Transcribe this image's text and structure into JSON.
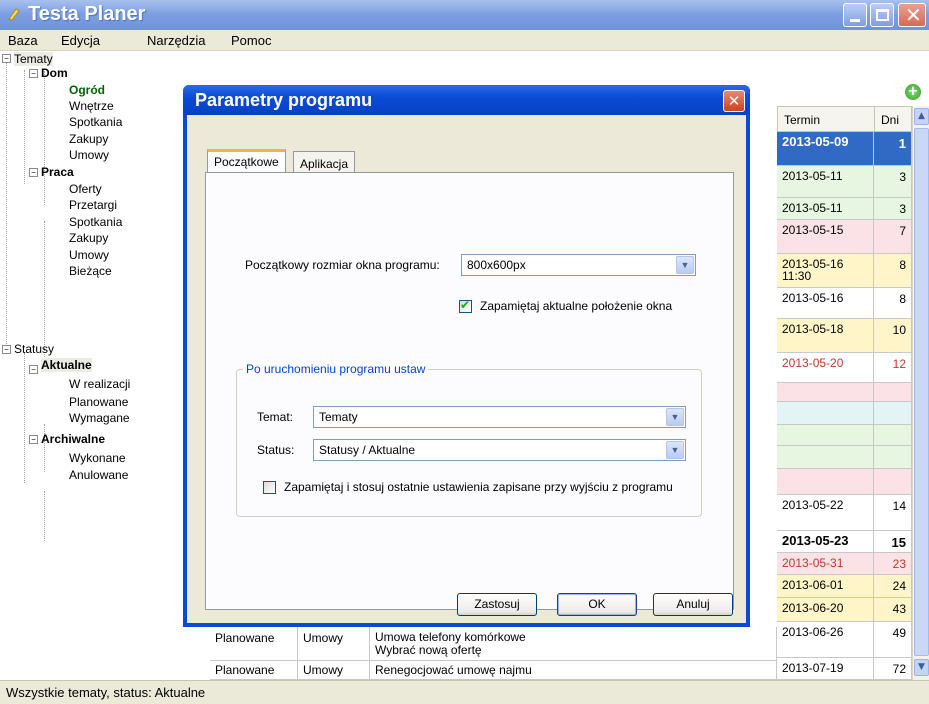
{
  "app": {
    "title": "Testa Planer",
    "menu": [
      "Baza",
      "Edycja",
      "Narzędzia",
      "Pomoc"
    ],
    "status": "Wszystkie tematy, status: Aktualne"
  },
  "tree": {
    "root1": "Tematy",
    "dom": "Dom",
    "dom_items": [
      "Ogród",
      "Wnętrze",
      "Spotkania",
      "Zakupy",
      "Umowy"
    ],
    "praca": "Praca",
    "praca_items": [
      "Oferty",
      "Przetargi",
      "Spotkania",
      "Zakupy",
      "Umowy",
      "Bieżące"
    ],
    "root2": "Statusy",
    "aktualne": "Aktualne",
    "aktualne_items": [
      "W realizacji",
      "Planowane",
      "Wymagane"
    ],
    "archiwalne": "Archiwalne",
    "archiwalne_items": [
      "Wykonane",
      "Anulowane"
    ]
  },
  "grid": {
    "headers": {
      "termin": "Termin",
      "dni": "Dni"
    },
    "rows": [
      {
        "termin": "2013-05-09",
        "dni": "1",
        "bg": "#316ac5",
        "color": "#ffffff",
        "bold": true
      },
      {
        "termin": "2013-05-11",
        "dni": "3",
        "bg": "#e6f6e0",
        "color": "#000000"
      },
      {
        "termin": "2013-05-11",
        "dni": "3",
        "bg": "#e6f6e0",
        "color": "#000000"
      },
      {
        "termin": "2013-05-15",
        "dni": "7",
        "bg": "#fbe2e6",
        "color": "#000000"
      },
      {
        "termin": "2013-05-16 11:30",
        "dni": "8",
        "bg": "#fff5c8",
        "color": "#000000"
      },
      {
        "termin": "2013-05-16",
        "dni": "8",
        "bg": "#ffffff",
        "color": "#000000"
      },
      {
        "termin": "2013-05-18",
        "dni": "10",
        "bg": "#fff5c8",
        "color": "#000000"
      },
      {
        "termin": "2013-05-20",
        "dni": "12",
        "bg": "#ffffff",
        "color": "#c0392b"
      },
      {
        "termin": "",
        "dni": "",
        "bg": "#fbe2e6",
        "color": "#000000"
      },
      {
        "termin": "",
        "dni": "",
        "bg": "#e2f4f6",
        "color": "#000000"
      },
      {
        "termin": "",
        "dni": "",
        "bg": "#e6f6e0",
        "color": "#000000"
      },
      {
        "termin": "",
        "dni": "",
        "bg": "#e6f6e0",
        "color": "#000000"
      },
      {
        "termin": "",
        "dni": "",
        "bg": "#fbe2e6",
        "color": "#000000"
      },
      {
        "termin": "2013-05-22",
        "dni": "14",
        "bg": "#ffffff",
        "color": "#000000"
      },
      {
        "termin": "2013-05-23",
        "dni": "15",
        "bg": "#ffffff",
        "color": "#000000",
        "bold": true
      },
      {
        "termin": "2013-05-31",
        "dni": "23",
        "bg": "#fbe2e6",
        "color": "#c0392b"
      },
      {
        "termin": "2013-06-01",
        "dni": "24",
        "bg": "#fff5c8",
        "color": "#000000"
      },
      {
        "termin": "2013-06-20",
        "dni": "43",
        "bg": "#fff5c8",
        "color": "#000000"
      },
      {
        "termin": "2013-06-26",
        "dni": "49",
        "bg": "#ffffff",
        "color": "#000000"
      },
      {
        "termin": "2013-07-19",
        "dni": "72",
        "bg": "#ffffff",
        "color": "#000000"
      }
    ],
    "left_rows": [
      {
        "status": "Planowane",
        "temat": "Umowy",
        "opis": "Umowa telefony komórkowe",
        "opis2": "Wybrać nową ofertę"
      },
      {
        "status": "Planowane",
        "temat": "Umowy",
        "opis": "Renegocjować umowę najmu",
        "opis2": ""
      }
    ]
  },
  "dialog": {
    "title": "Parametry programu",
    "tabs": [
      "Początkowe",
      "Aplikacja"
    ],
    "size_label": "Początkowy rozmiar okna programu:",
    "size_value": "800x600px",
    "remember_pos": "Zapamiętaj aktualne położenie okna",
    "group_title": "Po uruchomieniu programu ustaw",
    "temat_label": "Temat:",
    "temat_value": "Tematy",
    "status_label": "Status:",
    "status_value": "Statusy / Aktualne",
    "remember_settings": "Zapamiętaj i stosuj ostatnie ustawienia zapisane przy wyjściu z programu",
    "buttons": {
      "apply": "Zastosuj",
      "ok": "OK",
      "cancel": "Anuluj"
    }
  }
}
